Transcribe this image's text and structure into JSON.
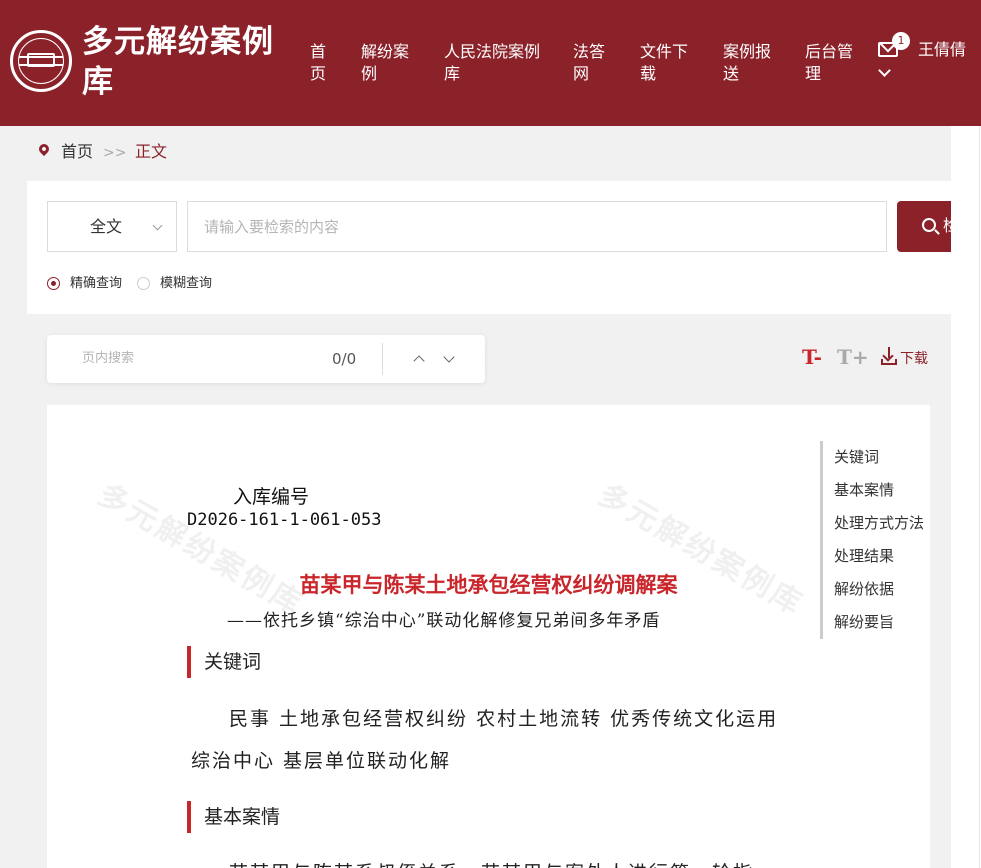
{
  "header": {
    "site_title": "多元解纷案例库",
    "nav": [
      "首页",
      "解纷案例",
      "人民法院案例库",
      "法答网",
      "文件下载",
      "案例报送",
      "后台管理"
    ],
    "mail_badge": "1",
    "username": "王倩倩",
    "bg_color": "#8b222a"
  },
  "breadcrumb": {
    "home": "首页",
    "separator": ">>",
    "current": "正文"
  },
  "search": {
    "scope": "全文",
    "placeholder": "请输入要检索的内容",
    "button_label": "检",
    "modes": [
      "精确查询",
      "模糊查询"
    ],
    "selected_mode": "精确查询"
  },
  "inpage_search": {
    "placeholder": "页内搜索",
    "count": "0/0"
  },
  "toolbar": {
    "font_decrease": "T-",
    "font_increase": "T+",
    "download": "下载"
  },
  "document": {
    "watermark": "多元解纷案例库",
    "case_number_label": "入库编号",
    "case_number": "D2026-161-1-061-053",
    "title": "苗某甲与陈某土地承包经营权纠纷调解案",
    "subtitle": "——依托乡镇“综治中心”联动化解修复兄弟间多年矛盾",
    "sections": [
      {
        "heading": "关键词",
        "text": "民事 土地承包经营权纠纷 农村土地流转 优秀传统文化运用 综治中心 基层单位联动化解"
      },
      {
        "heading": "基本案情",
        "text": "苗某甲与陈某系叔侄关系，苗某甲与案外人进行第一轮指"
      }
    ]
  },
  "toc": [
    "关键词",
    "基本案情",
    "处理方式方法",
    "处理结果",
    "解纷依据",
    "解纷要旨"
  ],
  "colors": {
    "accent": "#8b222a",
    "title_red": "#c9262c"
  }
}
